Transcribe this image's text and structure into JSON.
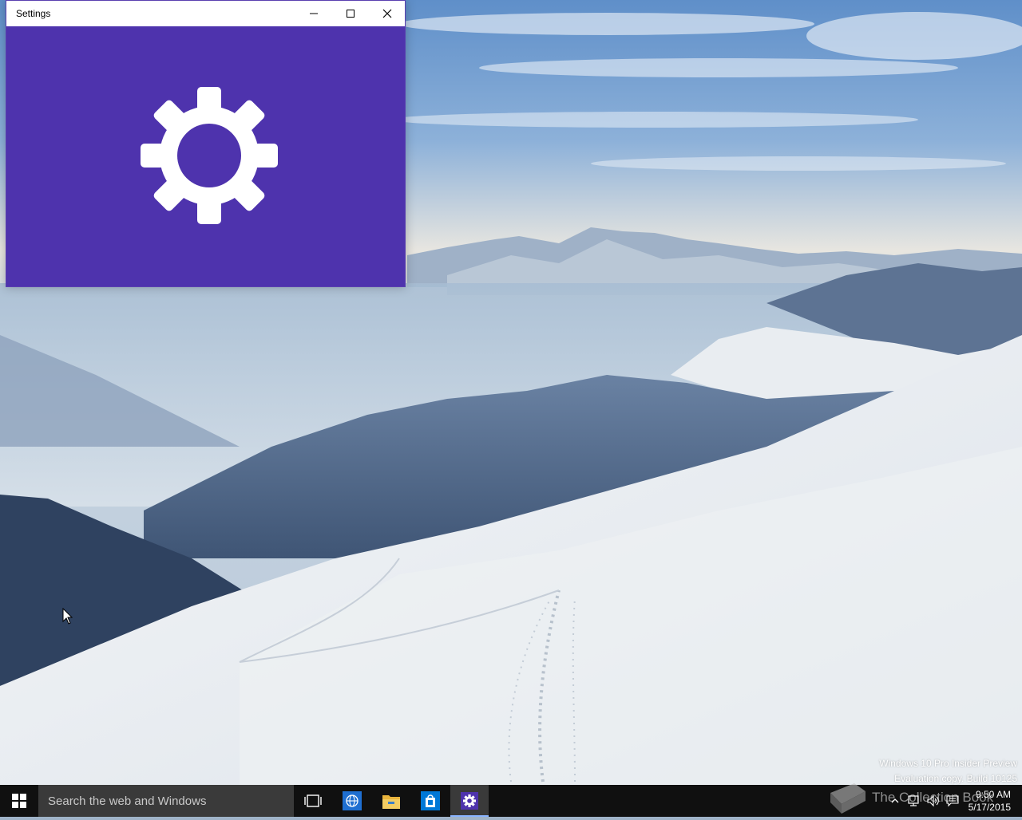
{
  "window": {
    "title": "Settings",
    "accent_color": "#4e33ad",
    "splash_icon": "gear-icon",
    "controls": {
      "minimize_icon": "minimize-icon",
      "maximize_icon": "maximize-icon",
      "close_icon": "close-icon"
    }
  },
  "desktop": {
    "watermark_line1": "Windows 10 Pro Insider Preview",
    "watermark_line2": "Evaluation copy. Build 10125"
  },
  "taskbar": {
    "search_placeholder": "Search the web and Windows",
    "start_icon": "windows-logo-icon",
    "pinned": [
      {
        "name": "Task View",
        "icon": "task-view-icon"
      },
      {
        "name": "Microsoft Edge",
        "icon": "globe-icon"
      },
      {
        "name": "File Explorer",
        "icon": "folder-icon"
      },
      {
        "name": "Store",
        "icon": "store-bag-icon"
      },
      {
        "name": "Settings",
        "icon": "gear-icon",
        "active": true
      }
    ],
    "tray_overlay_text": "The Collection Book",
    "tray": [
      "chevron-up-icon",
      "network-icon",
      "volume-icon",
      "action-center-icon"
    ],
    "clock_time": "9:50 AM",
    "clock_date": "5/17/2015"
  }
}
